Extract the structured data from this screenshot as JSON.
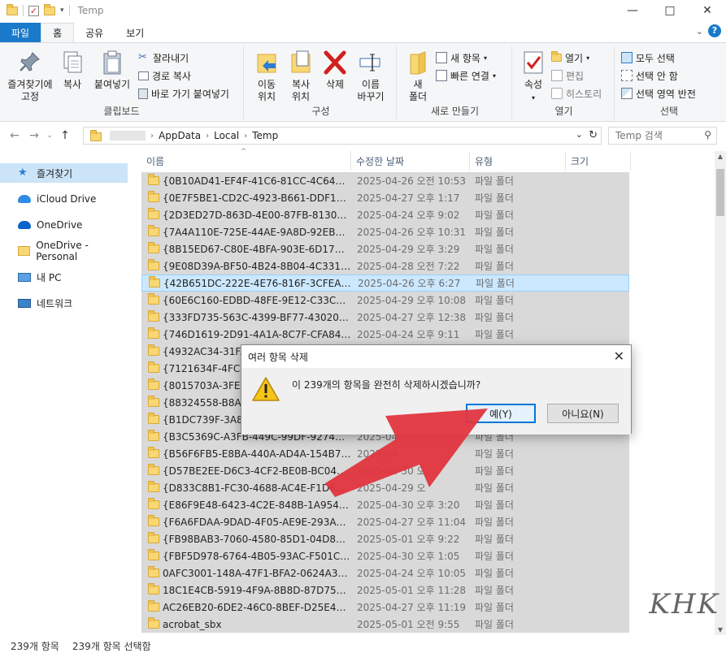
{
  "window": {
    "title": "Temp"
  },
  "ribbon_tabs": [
    {
      "label": "파일"
    },
    {
      "label": "홈"
    },
    {
      "label": "공유"
    },
    {
      "label": "보기"
    }
  ],
  "ribbon": {
    "clipboard": {
      "pin_label": "즐겨찾기에",
      "pin_label2": "고정",
      "copy_label": "복사",
      "paste_label": "붙여넣기",
      "cut_label": "잘라내기",
      "copy_path_label": "경로 복사",
      "paste_shortcut_label": "바로 가기 붙여넣기",
      "group_label": "클립보드"
    },
    "organize": {
      "move_label": "이동",
      "move_label2": "위치",
      "copyto_label": "복사",
      "copyto_label2": "위치",
      "delete_label": "삭제",
      "rename_label": "이름",
      "rename_label2": "바꾸기",
      "group_label": "구성"
    },
    "new": {
      "new_folder_label": "새",
      "new_folder_label2": "폴더",
      "new_item_label": "새 항목",
      "easy_access_label": "빠른 연결",
      "group_label": "새로 만들기"
    },
    "open": {
      "properties_label": "속성",
      "open_label": "열기",
      "edit_label": "편집",
      "history_label": "히스토리",
      "group_label": "열기"
    },
    "select": {
      "select_all_label": "모두 선택",
      "select_none_label": "선택 안 함",
      "invert_label": "선택 영역 반전",
      "group_label": "선택"
    }
  },
  "address": {
    "crumbs": [
      "AppData",
      "Local",
      "Temp"
    ],
    "search_placeholder": "Temp 검색"
  },
  "nav": [
    {
      "label": "즐겨찾기"
    },
    {
      "label": "iCloud Drive"
    },
    {
      "label": "OneDrive"
    },
    {
      "label": "OneDrive - Personal"
    },
    {
      "label": "내 PC"
    },
    {
      "label": "네트워크"
    }
  ],
  "columns": {
    "name": "이름",
    "modified": "수정한 날짜",
    "type": "유형",
    "size": "크기"
  },
  "files": [
    {
      "name": "{0B10AD41-EF4F-41C6-81CC-4C64241...",
      "date": "2025-04-26 오전 10:53",
      "type": "파일 폴더"
    },
    {
      "name": "{0E7F5BE1-CD2C-4923-B661-DDF1744...",
      "date": "2025-04-27 오후 1:17",
      "type": "파일 폴더"
    },
    {
      "name": "{2D3ED27D-863D-4E00-87FB-813033...",
      "date": "2025-04-24 오후 9:02",
      "type": "파일 폴더"
    },
    {
      "name": "{7A4A110E-725E-44AE-9A8D-92EB57F...",
      "date": "2025-04-26 오후 10:31",
      "type": "파일 폴더"
    },
    {
      "name": "{8B15ED67-C80E-4BFA-903E-6D17D1F...",
      "date": "2025-04-29 오후 3:29",
      "type": "파일 폴더"
    },
    {
      "name": "{9E08D39A-BF50-4B24-8B04-4C3317C...",
      "date": "2025-04-28 오전 7:22",
      "type": "파일 폴더"
    },
    {
      "name": "{42B651DC-222E-4E76-816F-3CFEA34...",
      "date": "2025-04-26 오후 6:27",
      "type": "파일 폴더"
    },
    {
      "name": "{60E6C160-EDBD-48FE-9E12-C33CAE0...",
      "date": "2025-04-29 오후 10:08",
      "type": "파일 폴더"
    },
    {
      "name": "{333FD735-563C-4399-BF77-430204A...",
      "date": "2025-04-27 오후 12:38",
      "type": "파일 폴더"
    },
    {
      "name": "{746D1619-2D91-4A1A-8C7F-CFA84D...",
      "date": "2025-04-24 오후 9:11",
      "type": "파일 폴더"
    },
    {
      "name": "{4932AC34-31FA",
      "date": "",
      "type": ""
    },
    {
      "name": "{7121634F-4FCE-",
      "date": "",
      "type": ""
    },
    {
      "name": "{8015703A-3FEE-",
      "date": "",
      "type": ""
    },
    {
      "name": "{88324558-B8A7-",
      "date": "",
      "type": ""
    },
    {
      "name": "{B1DC739F-3A8D",
      "date": "",
      "type": ""
    },
    {
      "name": "{B3C5369C-A3FB-449C-99DF-9274BA...",
      "date": "2025-04",
      "type": "파일 폴더"
    },
    {
      "name": "{B56F6FB5-E8BA-440A-AD4A-154B75E...",
      "date": "2025-04",
      "type": "파일 폴더"
    },
    {
      "name": "{D57BE2EE-D6C3-4CF2-BE0B-BC042BA...",
      "date": "2025-04-30 오",
      "type": "파일 폴더"
    },
    {
      "name": "{D833C8B1-FC30-4688-AC4E-F1D6A8...",
      "date": "2025-04-29 오",
      "type": "파일 폴더"
    },
    {
      "name": "{E86F9E48-6423-4C2E-848B-1A95449...",
      "date": "2025-04-30 오후 3:20",
      "type": "파일 폴더"
    },
    {
      "name": "{F6A6FDAA-9DAD-4F05-AE9E-293A2D...",
      "date": "2025-04-27 오후 11:04",
      "type": "파일 폴더"
    },
    {
      "name": "{FB98BAB3-7060-4580-85D1-04D8DB...",
      "date": "2025-05-01 오후 9:22",
      "type": "파일 폴더"
    },
    {
      "name": "{FBF5D978-6764-4B05-93AC-F501C6D...",
      "date": "2025-04-30 오후 1:05",
      "type": "파일 폴더"
    },
    {
      "name": "0AFC3001-148A-47F1-BFA2-0624A3A...",
      "date": "2025-04-24 오후 10:05",
      "type": "파일 폴더"
    },
    {
      "name": "18C1E4CB-5919-4F9A-8B8D-87D7514...",
      "date": "2025-05-01 오후 11:28",
      "type": "파일 폴더"
    },
    {
      "name": "AC26EB20-6DE2-46C0-8BEF-D25E442...",
      "date": "2025-04-27 오후 11:19",
      "type": "파일 폴더"
    },
    {
      "name": "acrobat_sbx",
      "date": "2025-05-01 오전 9:55",
      "type": "파일 폴더"
    }
  ],
  "focused_row_index": 6,
  "dialog": {
    "title": "여러 항목 삭제",
    "message": "이 239개의 항목을 완전히 삭제하시겠습니까?",
    "yes_label": "예(Y)",
    "no_label": "아니요(N)"
  },
  "status": {
    "count": "239개 항목",
    "selected": "239개 항목 선택함"
  },
  "watermark": "KHK",
  "colors": {
    "accent": "#1979ca",
    "arrow": "#e0353f",
    "selection": "#d9d9d9",
    "focus": "#cce8ff"
  }
}
